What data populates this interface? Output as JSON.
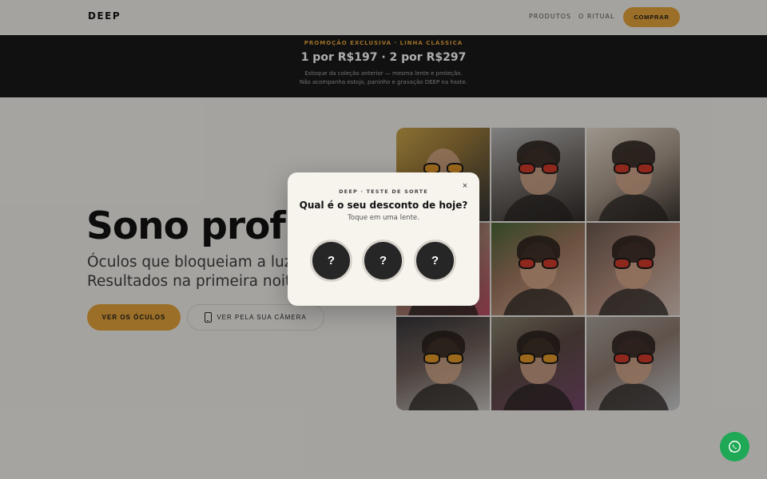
{
  "header": {
    "logo": "DEEP",
    "nav": [
      {
        "label": "PRODUTOS"
      },
      {
        "label": "O RITUAL"
      }
    ],
    "cta_label": "COMPRAR"
  },
  "promo": {
    "label": "PROMOÇÃO EXCLUSIVA · LINHA CLÁSSICA",
    "price": "1 por R$197 · 2 por R$297",
    "note_line1": "Estoque da coleção anterior — mesma lente e proteção.",
    "note_line2": "Não acompanha estojo, paninho e gravação DEEP na haste."
  },
  "hero": {
    "title": "Sono profundo",
    "subtitle_line1": "Óculos que bloqueiam a luz azul.",
    "subtitle_line2": "Resultados na primeira noite.",
    "primary_button": "VER OS ÓCULOS",
    "secondary_button": "VER PELA SUA CÂMERA"
  },
  "gallery": {
    "tiles": [
      {
        "lens": "amber"
      },
      {
        "lens": "red"
      },
      {
        "lens": "red"
      },
      {
        "lens": "red"
      },
      {
        "lens": "red"
      },
      {
        "lens": "red"
      },
      {
        "lens": "amber"
      },
      {
        "lens": "amber"
      },
      {
        "lens": "red"
      }
    ]
  },
  "modal": {
    "close_label": "×",
    "eyebrow": "DEEP · TESTE DE SORTE",
    "title": "Qual é o seu desconto de hoje?",
    "subtitle": "Toque em uma lente.",
    "choices": [
      "?",
      "?",
      "?"
    ]
  },
  "colors": {
    "accent": "#e6a43c",
    "promo_bg": "#1a1a1a",
    "page_bg": "#f3f1ec",
    "whatsapp": "#1fa855"
  },
  "icons": {
    "phone": "phone-icon",
    "whatsapp": "whatsapp-icon"
  }
}
